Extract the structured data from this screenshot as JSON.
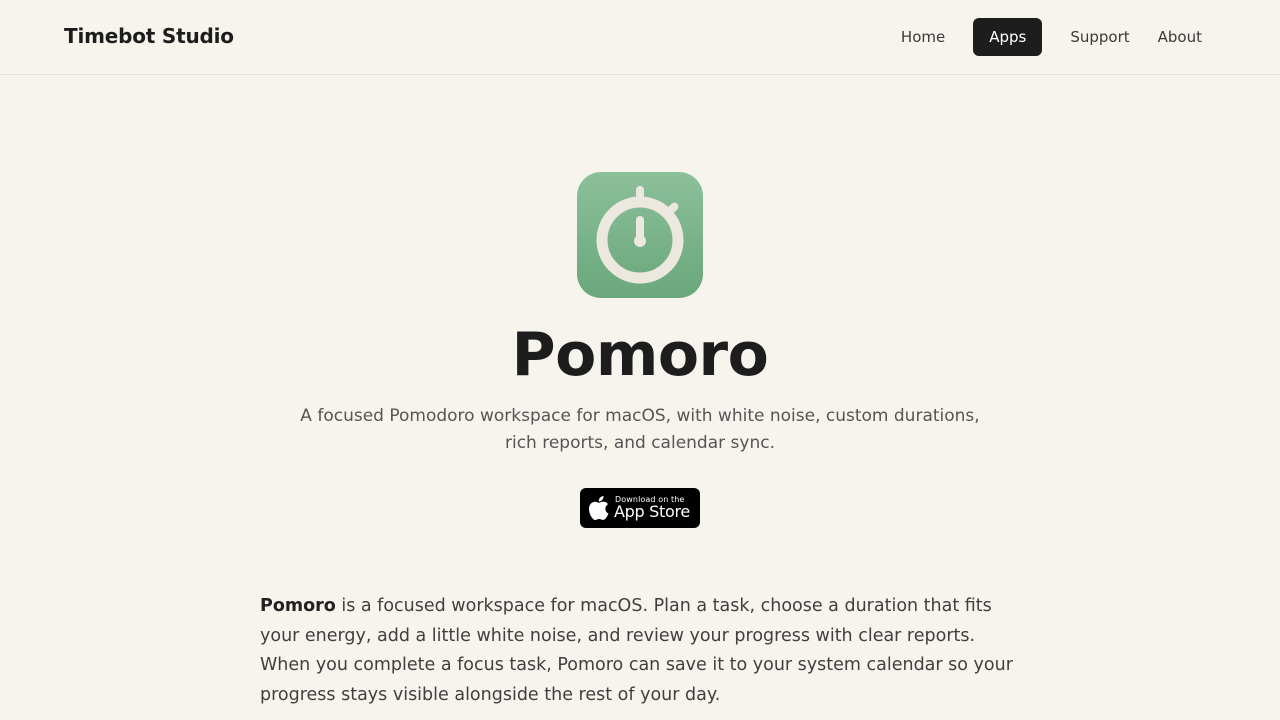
{
  "header": {
    "brand": "Timebot Studio",
    "nav": [
      {
        "label": "Home",
        "active": false
      },
      {
        "label": "Apps",
        "active": true
      },
      {
        "label": "Support",
        "active": false
      },
      {
        "label": "About",
        "active": false
      }
    ]
  },
  "hero": {
    "app_icon": "stopwatch-icon",
    "title": "Pomoro",
    "tagline": "A focused Pomodoro workspace for macOS, with white noise, custom durations, rich reports, and calendar sync.",
    "store_button": {
      "small_text": "Download on the",
      "big_text": "App Store",
      "icon": "apple-icon"
    }
  },
  "description": {
    "bold_lead": "Pomoro",
    "text": " is a focused workspace for macOS. Plan a task, choose a duration that fits your energy, add a little white noise, and review your progress with clear reports. When you complete a focus task, Pomoro can save it to your system calendar so your progress stays visible alongside the rest of your day."
  },
  "colors": {
    "background": "#f7f4ee",
    "accent_dark": "#1d1d1d",
    "icon_green": "#7bb38a"
  }
}
